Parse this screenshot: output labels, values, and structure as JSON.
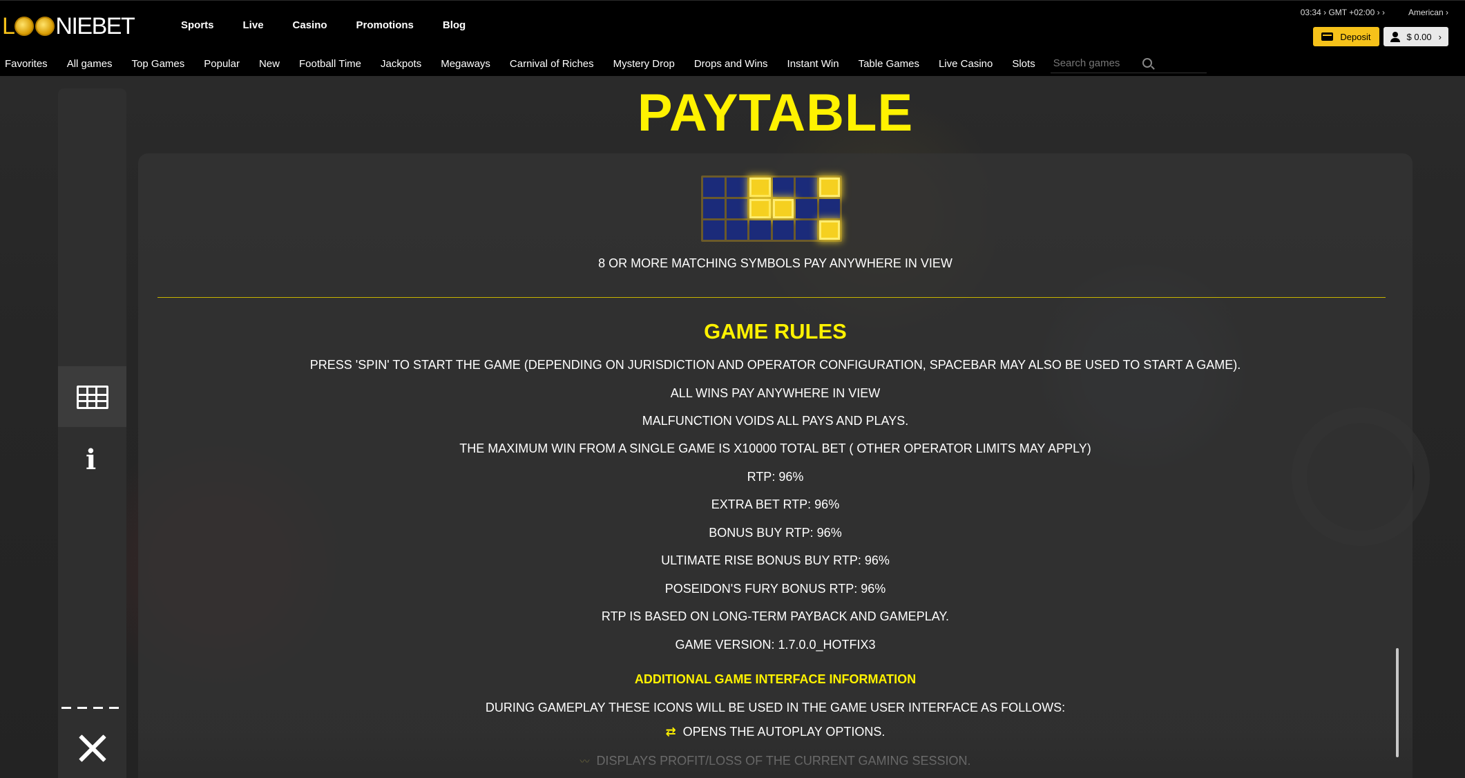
{
  "header": {
    "logo_text_first": "L",
    "logo_text_nie": "NIE",
    "logo_text_bet": "BET",
    "nav": [
      "Sports",
      "Live",
      "Casino",
      "Promotions",
      "Blog"
    ],
    "time": "03:34",
    "timezone": "GMT +02:00",
    "odds_format": "American",
    "deposit_label": "Deposit",
    "balance": "$ 0.00"
  },
  "categories": [
    "Favorites",
    "All games",
    "Top Games",
    "Popular",
    "New",
    "Football Time",
    "Jackpots",
    "Megaways",
    "Carnival of Riches",
    "Mystery Drop",
    "Drops and Wins",
    "Instant Win",
    "Table Games",
    "Live Casino",
    "Slots"
  ],
  "search": {
    "placeholder": "Search games"
  },
  "paytable": {
    "title": "PAYTABLE",
    "pay_board_hits": [
      [
        0,
        2
      ],
      [
        0,
        5
      ],
      [
        1,
        2
      ],
      [
        1,
        3
      ],
      [
        2,
        5
      ]
    ],
    "caption": "8 OR MORE MATCHING SYMBOLS PAY ANYWHERE IN VIEW"
  },
  "game_rules": {
    "title": "GAME RULES",
    "lines": [
      "PRESS 'SPIN' TO START THE GAME (DEPENDING ON JURISDICTION AND OPERATOR CONFIGURATION, SPACEBAR MAY ALSO BE USED TO START A GAME).",
      "ALL WINS PAY ANYWHERE IN VIEW",
      "MALFUNCTION VOIDS ALL PAYS AND PLAYS.",
      "THE MAXIMUM WIN FROM A SINGLE GAME IS X10000 TOTAL BET ( OTHER OPERATOR LIMITS MAY APPLY)",
      "RTP: 96%",
      "EXTRA BET RTP: 96%",
      "BONUS BUY RTP: 96%",
      "ULTIMATE RISE BONUS BUY RTP: 96%",
      "POSEIDON'S FURY BONUS RTP: 96%",
      "RTP IS BASED ON LONG-TERM PAYBACK AND GAMEPLAY.",
      "GAME VERSION: 1.7.0.0_HOTFIX3"
    ]
  },
  "additional_info": {
    "title": "ADDITIONAL GAME INTERFACE INFORMATION",
    "intro": "DURING GAMEPLAY THESE ICONS WILL BE USED IN THE GAME USER INTERFACE AS FOLLOWS:",
    "autoplay": "OPENS THE AUTOPLAY OPTIONS.",
    "profit": "DISPLAYS PROFIT/LOSS OF THE CURRENT GAMING SESSION."
  },
  "icons": {
    "search": "search-icon",
    "paytable": "paytable-grid-icon",
    "info": "info-icon",
    "close": "close-icon",
    "autoplay": "autoplay-icon",
    "profit": "profit-loss-icon"
  },
  "colors": {
    "accent_yellow": "#fff200",
    "brand_gold": "#f6c21a",
    "board_blue": "#1b2b7a"
  }
}
